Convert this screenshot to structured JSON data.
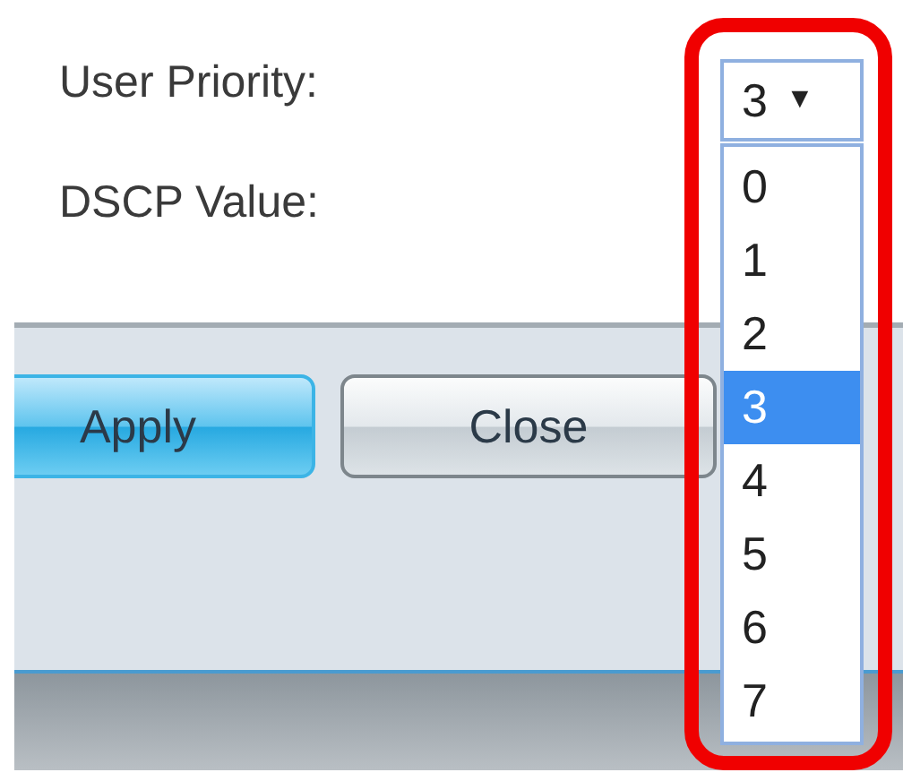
{
  "fields": [
    {
      "label": "User Priority:"
    },
    {
      "label": "DSCP Value:"
    }
  ],
  "user_priority_dropdown": {
    "value": "3",
    "arrow": "▼",
    "expanded": true,
    "options": [
      {
        "label": "0",
        "selected": false
      },
      {
        "label": "1",
        "selected": false
      },
      {
        "label": "2",
        "selected": false
      },
      {
        "label": "3",
        "selected": true
      },
      {
        "label": "4",
        "selected": false
      },
      {
        "label": "5",
        "selected": false
      },
      {
        "label": "6",
        "selected": false
      },
      {
        "label": "7",
        "selected": false
      }
    ]
  },
  "buttons": [
    {
      "label": "Apply",
      "kind": "primary"
    },
    {
      "label": "Close",
      "kind": "secondary"
    }
  ]
}
